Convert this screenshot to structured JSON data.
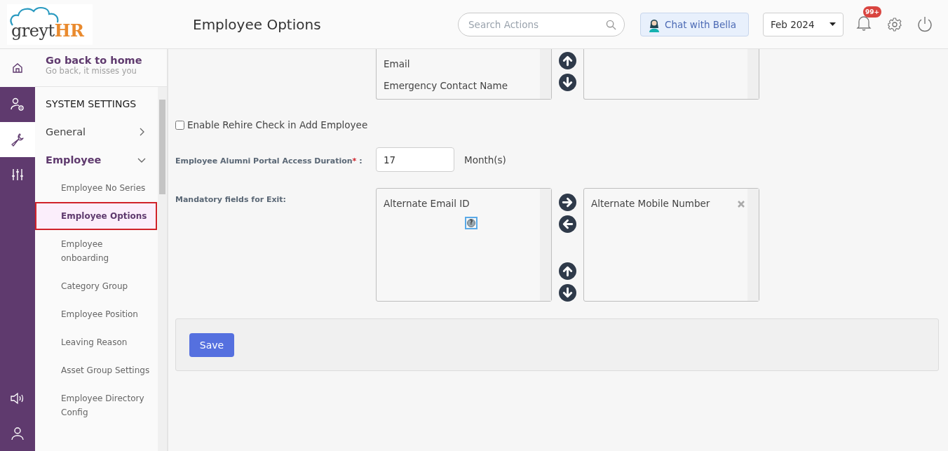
{
  "header": {
    "logo_main": "greyt",
    "logo_accent": "HR",
    "title": "Employee Options",
    "search": {
      "placeholder": "Search Actions"
    },
    "chat_button": "Chat with Bella",
    "period": "Feb 2024",
    "notification_badge": "99+"
  },
  "rail": {
    "top": [
      {
        "kind": "user-settings",
        "selected": false
      },
      {
        "kind": "wrench",
        "selected": true
      },
      {
        "kind": "sliders",
        "selected": false
      }
    ],
    "bottom": [
      {
        "kind": "speaker",
        "selected": false
      },
      {
        "kind": "person",
        "selected": false
      }
    ]
  },
  "sidebar": {
    "home_link": {
      "title": "Go back to home",
      "subtitle": "Go back, it misses you"
    },
    "section": "SYSTEM SETTINGS",
    "items": [
      {
        "label": "General",
        "expanded": false
      },
      {
        "label": "Employee",
        "expanded": true,
        "children": [
          {
            "label": "Employee No Series",
            "selected": false
          },
          {
            "label": "Employee Options",
            "selected": true
          },
          {
            "label": "Employee onboarding",
            "selected": false
          },
          {
            "label": "Category Group",
            "selected": false
          },
          {
            "label": "Employee Position",
            "selected": false
          },
          {
            "label": "Leaving Reason",
            "selected": false
          },
          {
            "label": "Asset Group Settings",
            "selected": false
          },
          {
            "label": "Employee Directory Config",
            "selected": false
          }
        ]
      }
    ]
  },
  "top_list": {
    "available": [
      "Email",
      "Emergency Contact Name"
    ]
  },
  "rehire_check": {
    "label": "Enable Rehire Check in Add Employee",
    "checked": false
  },
  "alumni_duration": {
    "label": "Employee Alumni Portal Access Duration",
    "required_mark": "*",
    "suffix": ":",
    "value": "17",
    "unit": "Month(s)"
  },
  "exit_fields": {
    "label": "Mandatory fields for Exit:",
    "help_mark": "?",
    "available": [
      "Alternate Email ID"
    ],
    "chosen": [
      "Alternate Mobile Number"
    ]
  },
  "save_button": "Save"
}
